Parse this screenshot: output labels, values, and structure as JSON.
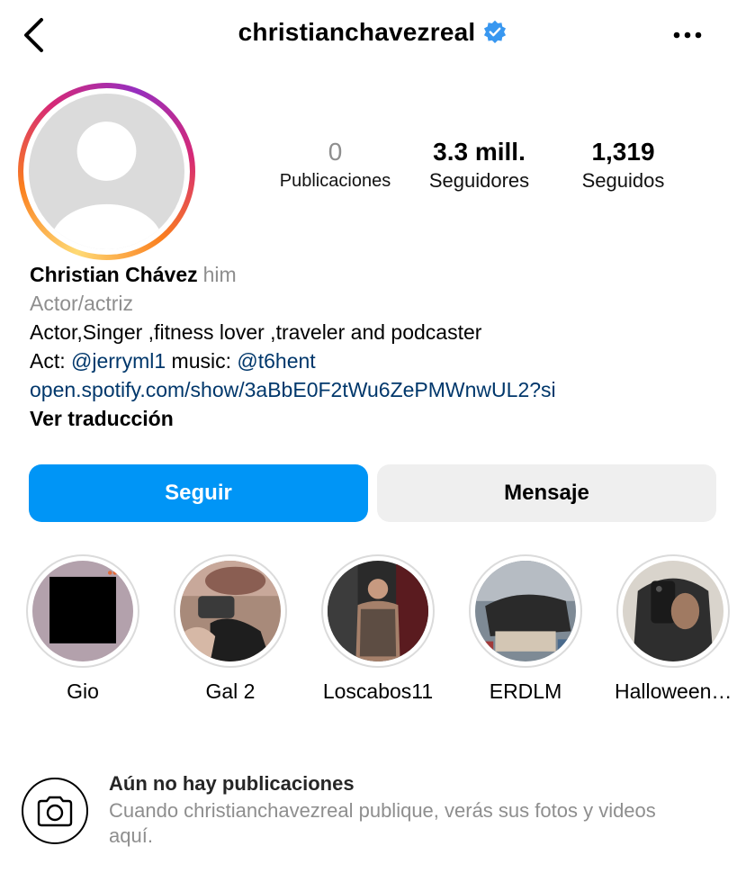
{
  "header": {
    "username": "christianchavezreal",
    "verified_icon": "verified-badge-icon",
    "back_icon": "chevron-left-icon",
    "more_icon": "more-horizontal-icon"
  },
  "stats": {
    "posts_count": "0",
    "posts_label": "Publicaciones",
    "followers_count": "3.3 mill.",
    "followers_label": "Seguidores",
    "following_count": "1,319",
    "following_label": "Seguidos"
  },
  "bio": {
    "name": "Christian Chávez",
    "pronouns": "him",
    "category": "Actor/actriz",
    "line1": "Actor,Singer ,fitness lover ,traveler and podcaster",
    "line2_prefix": "Act: ",
    "line2_mention1": "@jerryml1",
    "line2_middle": " music: ",
    "line2_mention2": "@t6hent",
    "link": "open.spotify.com/show/3aBbE0F2tWu6ZePMWnwUL2?si",
    "translate": "Ver traducción"
  },
  "actions": {
    "follow_label": "Seguir",
    "message_label": "Mensaje"
  },
  "highlights": [
    {
      "label": "Gio"
    },
    {
      "label": "Gal 2"
    },
    {
      "label": "Loscabos11"
    },
    {
      "label": "ERDLM"
    },
    {
      "label": "Halloween…"
    }
  ],
  "empty_state": {
    "title": "Aún no hay publicaciones",
    "description": "Cuando christianchavezreal publique, verás sus fotos y videos aquí.",
    "icon": "camera-icon"
  },
  "colors": {
    "primary": "#0095f6",
    "secondary_button": "#efefef",
    "link": "#00376b",
    "muted": "#8e8e8e",
    "verified": "#3897f0"
  }
}
